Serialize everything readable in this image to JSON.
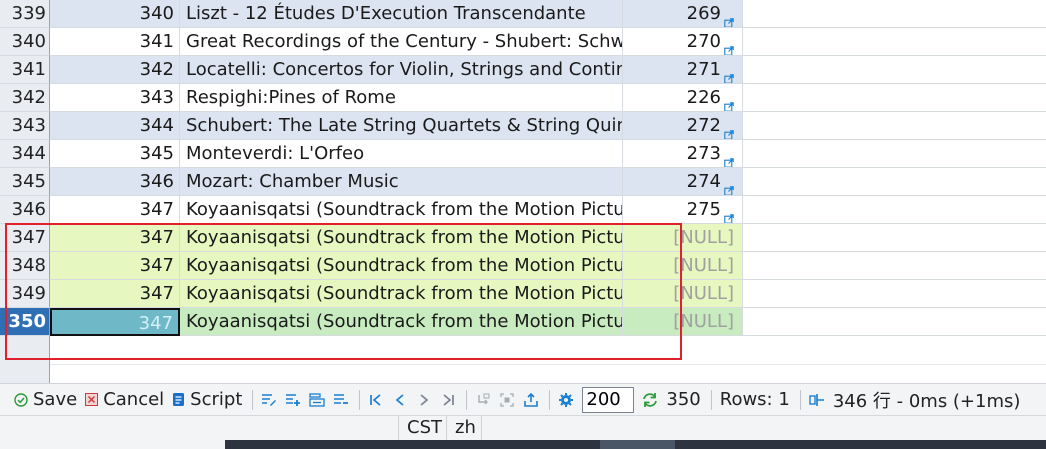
{
  "grid": {
    "rows": [
      {
        "rownum": "339",
        "id": "340",
        "title": "Liszt - 12 Études D'Execution Transcendante",
        "ref": "269",
        "style": "alt",
        "link": true
      },
      {
        "rownum": "340",
        "id": "341",
        "title": "Great Recordings of the Century - Shubert: Schwan",
        "ref": "270",
        "style": "plain",
        "link": true
      },
      {
        "rownum": "341",
        "id": "342",
        "title": "Locatelli: Concertos for Violin, Strings and Continuc",
        "ref": "271",
        "style": "alt",
        "link": true
      },
      {
        "rownum": "342",
        "id": "343",
        "title": "Respighi:Pines of Rome",
        "ref": "226",
        "style": "plain",
        "link": true
      },
      {
        "rownum": "343",
        "id": "344",
        "title": "Schubert: The Late String Quartets & String Quinte",
        "ref": "272",
        "style": "alt",
        "link": true
      },
      {
        "rownum": "344",
        "id": "345",
        "title": "Monteverdi: L'Orfeo",
        "ref": "273",
        "style": "plain",
        "link": true
      },
      {
        "rownum": "345",
        "id": "346",
        "title": "Mozart: Chamber Music",
        "ref": "274",
        "style": "alt",
        "link": true
      },
      {
        "rownum": "346",
        "id": "347",
        "title": "Koyaanisqatsi (Soundtrack from the Motion Picture",
        "ref": "275",
        "style": "plain",
        "link": true
      },
      {
        "rownum": "347",
        "id": "347",
        "title": "Koyaanisqatsi (Soundtrack from the Motion Picture",
        "ref": "[NULL]",
        "style": "new",
        "link": false
      },
      {
        "rownum": "348",
        "id": "347",
        "title": "Koyaanisqatsi (Soundtrack from the Motion Picture",
        "ref": "[NULL]",
        "style": "new",
        "link": false
      },
      {
        "rownum": "349",
        "id": "347",
        "title": "Koyaanisqatsi (Soundtrack from the Motion Picture",
        "ref": "[NULL]",
        "style": "new",
        "link": false
      },
      {
        "rownum": "350",
        "id": "347",
        "title": "Koyaanisqatsi (Soundtrack from the Motion Picture",
        "ref": "[NULL]",
        "style": "sel",
        "link": false
      }
    ]
  },
  "toolbar": {
    "save_label": "Save",
    "cancel_label": "Cancel",
    "script_label": "Script",
    "limit_value": "200",
    "refresh_count": "350",
    "rows_label": "Rows: 1",
    "timing_label": "346 行 - 0ms (+1ms)"
  },
  "statusbar": {
    "timezone": "CST",
    "locale": "zh"
  },
  "colors": {
    "accent": "#1a7fd0",
    "highlight_box": "#e0212b",
    "new_row": "#e6f7bf",
    "alt_row": "#dbe4f0"
  }
}
